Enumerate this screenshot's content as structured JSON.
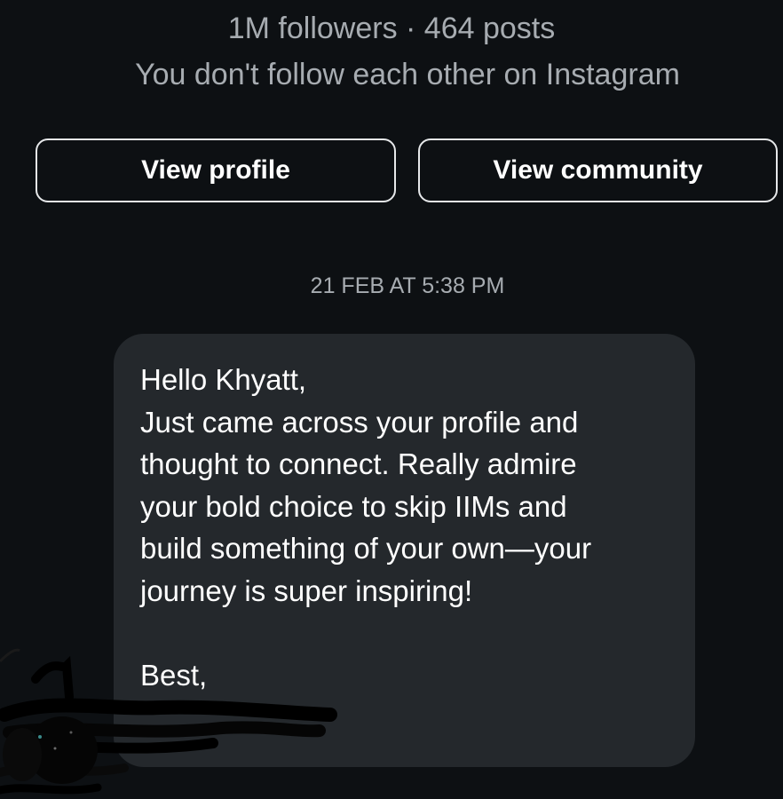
{
  "profile": {
    "stats": "1M followers · 464 posts",
    "relationship_note": "You don't follow each other on Instagram"
  },
  "actions": {
    "view_profile_label": "View profile",
    "view_community_label": "View community"
  },
  "conversation": {
    "timestamp": "21 FEB AT 5:38 PM",
    "message": {
      "greeting": "Hello Khyatt,",
      "line1": "Just came across your profile and",
      "line2": "thought to connect. Really admire",
      "line3": "your bold choice to skip IIMs and",
      "line4": "build something of your own—your",
      "line5": "journey is super inspiring!",
      "signoff": "Best,"
    }
  },
  "colors": {
    "background": "#0d1013",
    "bubble": "#24282c",
    "muted_text": "#a7acb1",
    "button_border": "#e6e8ea"
  }
}
